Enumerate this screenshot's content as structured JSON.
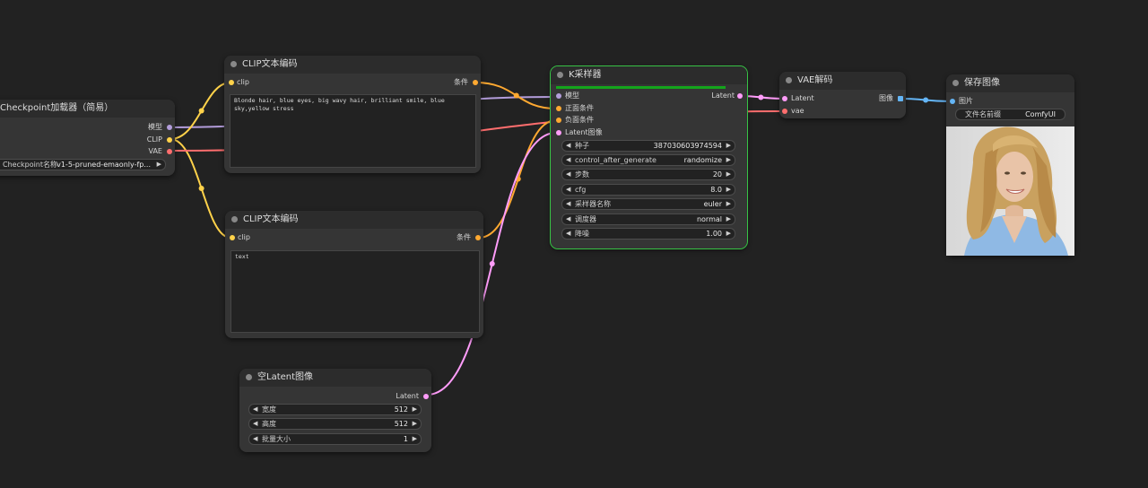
{
  "colors": {
    "model": "#b39ddb",
    "clip": "#ffd24a",
    "vae": "#ff6e6e",
    "conditioning": "#ffa931",
    "latent": "#ff9cf9",
    "image": "#64b5f6",
    "selected_outline": "#37c245",
    "progress": "#14a51c"
  },
  "checkpoint_loader": {
    "title": "Checkpoint加载器（简易）",
    "outputs": [
      "模型",
      "CLIP",
      "VAE"
    ],
    "ckpt_label": "Checkpoint名称",
    "ckpt_value": "v1-5-pruned-emaonly-fp..."
  },
  "clip_encode_positive": {
    "title": "CLIP文本编码",
    "input": "clip",
    "output": "条件",
    "text": "Blonde hair, blue eyes, big wavy hair, brilliant smile, blue sky,yellow stress"
  },
  "clip_encode_negative": {
    "title": "CLIP文本编码",
    "input": "clip",
    "output": "条件",
    "text": "text"
  },
  "empty_latent": {
    "title": "空Latent图像",
    "output": "Latent",
    "widgets": [
      {
        "label": "宽度",
        "value": "512"
      },
      {
        "label": "高度",
        "value": "512"
      },
      {
        "label": "批量大小",
        "value": "1"
      }
    ]
  },
  "ksampler": {
    "title": "K采样器",
    "progress": 1.0,
    "inputs": [
      "模型",
      "正面条件",
      "负面条件",
      "Latent图像"
    ],
    "output": "Latent",
    "widgets": [
      {
        "label": "种子",
        "value": "387030603974594"
      },
      {
        "label": "control_after_generate",
        "value": "randomize"
      },
      {
        "label": "步数",
        "value": "20"
      },
      {
        "label": "cfg",
        "value": "8.0"
      },
      {
        "label": "采样器名称",
        "value": "euler"
      },
      {
        "label": "调度器",
        "value": "normal"
      },
      {
        "label": "降噪",
        "value": "1.00"
      }
    ]
  },
  "vae_decode": {
    "title": "VAE解码",
    "inputs": [
      "Latent",
      "vae"
    ],
    "output": "图像"
  },
  "save_image": {
    "title": "保存图像",
    "input": "图片",
    "prefix_label": "文件名前缀",
    "prefix_value": "ComfyUI"
  },
  "icons": {
    "arrow_left": "◀",
    "arrow_right": "▶"
  }
}
